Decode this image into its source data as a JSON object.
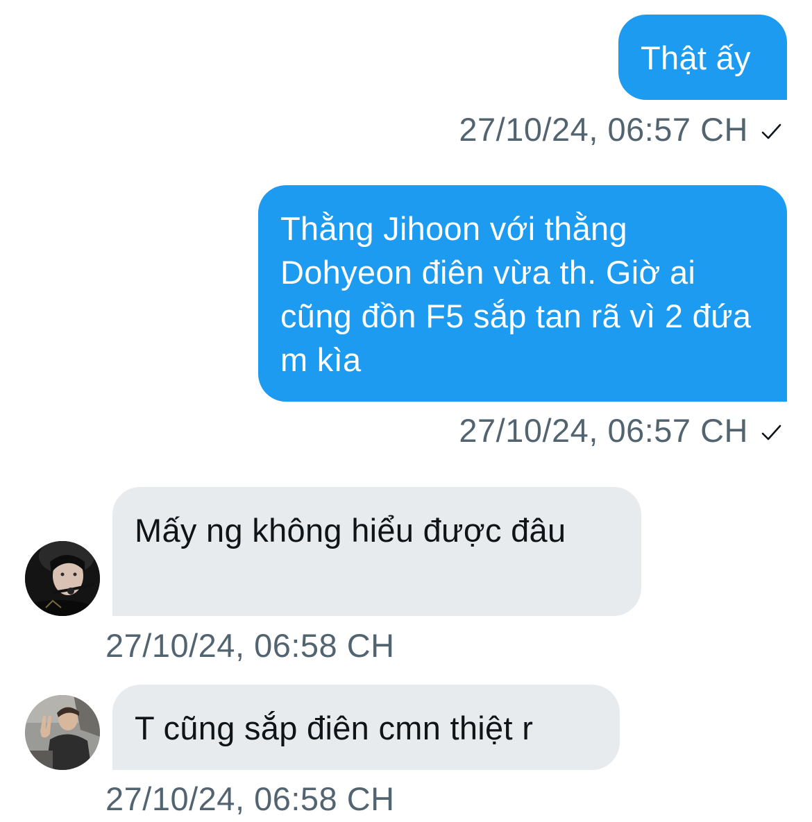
{
  "messages": [
    {
      "direction": "outgoing",
      "text": "Thật ấy",
      "timestamp": "27/10/24, 06:57 CH",
      "status_icon": "check-icon"
    },
    {
      "direction": "outgoing",
      "text": "Thằng Jihoon với thằng Dohyeon điên vừa th. Giờ ai cũng đồn F5 sắp tan rã vì 2 đứa m kìa",
      "timestamp": "27/10/24, 06:57 CH",
      "status_icon": "check-icon"
    },
    {
      "direction": "incoming",
      "text": "Mấy ng không hiểu được đâu",
      "timestamp": "27/10/24, 06:58 CH",
      "avatar": "avatar-dark-headset"
    },
    {
      "direction": "incoming",
      "text": "T cũng sắp điên cmn thiệt r",
      "timestamp": "27/10/24, 06:58 CH",
      "avatar": "avatar-peace-sign"
    }
  ],
  "colors": {
    "outgoing_bubble": "#1d9bf0",
    "incoming_bubble": "#e7ebee",
    "timestamp_text": "#536471",
    "incoming_text": "#0f1419"
  }
}
